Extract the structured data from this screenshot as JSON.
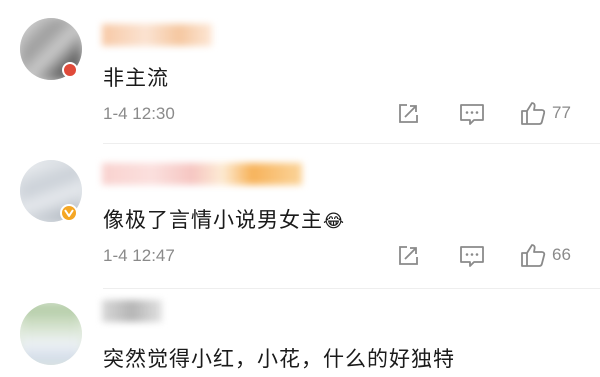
{
  "comments": [
    {
      "text": "非主流",
      "time": "1-4 12:30",
      "likes": "77"
    },
    {
      "text": "像极了言情小说男女主",
      "emoji": "😂",
      "time": "1-4 12:47",
      "likes": "66"
    },
    {
      "text": "突然觉得小红，小花，什么的好独特"
    }
  ],
  "icons": {
    "share": "share-icon",
    "reply": "comment-icon",
    "like": "thumbs-up-icon"
  },
  "colors": {
    "accent_badge": "#f5a623",
    "muted": "#8a8a8a",
    "text": "#1a1a1a"
  }
}
